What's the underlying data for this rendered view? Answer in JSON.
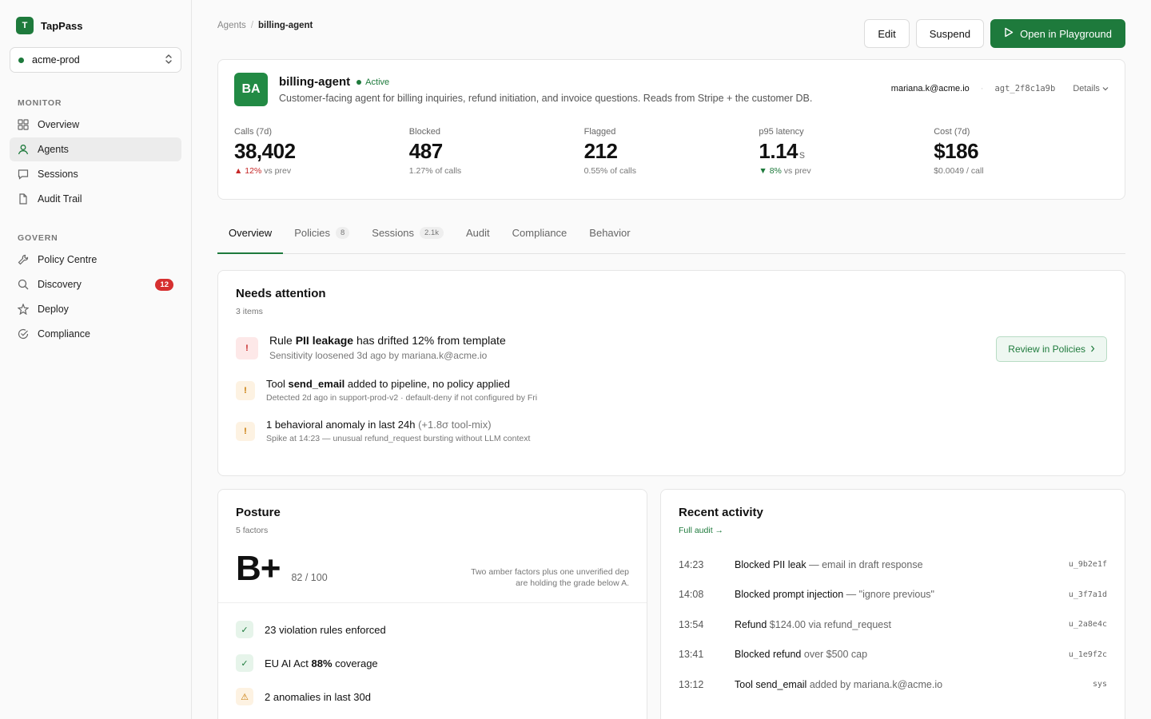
{
  "brand": {
    "logo_letter": "T",
    "name": "TapPass"
  },
  "environment": {
    "name": "acme-prod",
    "status_color": "#1e7a3c"
  },
  "sidebar": {
    "sections": [
      {
        "title": "MONITOR",
        "items": [
          {
            "label": "Overview",
            "icon": "grid-icon"
          },
          {
            "label": "Agents",
            "icon": "user-icon",
            "active": true
          },
          {
            "label": "Sessions",
            "icon": "chat-icon"
          },
          {
            "label": "Audit Trail",
            "icon": "document-icon"
          }
        ]
      },
      {
        "title": "GOVERN",
        "items": [
          {
            "label": "Policy Centre",
            "icon": "wrench-icon"
          },
          {
            "label": "Discovery",
            "icon": "search-icon",
            "badge": "12"
          },
          {
            "label": "Deploy",
            "icon": "sparkle-icon"
          },
          {
            "label": "Compliance",
            "icon": "check-circle-icon"
          }
        ]
      }
    ]
  },
  "breadcrumb": {
    "parent": "Agents",
    "current": "billing-agent"
  },
  "toolbar": {
    "edit_label": "Edit",
    "suspend_label": "Suspend",
    "playground_label": "Open in Playground"
  },
  "agent": {
    "initials": "BA",
    "name": "billing-agent",
    "status": "Active",
    "description": "Customer-facing agent for billing inquiries, refund initiation, and invoice questions. Reads from Stripe + the customer DB.",
    "owner": "mariana.k@acme.io",
    "id": "agt_2f8c1a9b",
    "details_label": "Details"
  },
  "stats": [
    {
      "label": "Calls (7d)",
      "value": "38,402",
      "unit": "",
      "sub_change": "▲ 12%",
      "sub_change_dir": "up",
      "sub_text": " vs prev"
    },
    {
      "label": "Blocked",
      "value": "487",
      "unit": "",
      "sub_change": "",
      "sub_change_dir": "",
      "sub_text": "1.27% of calls"
    },
    {
      "label": "Flagged",
      "value": "212",
      "unit": "",
      "sub_change": "",
      "sub_change_dir": "",
      "sub_text": "0.55% of calls"
    },
    {
      "label": "p95 latency",
      "value": "1.14",
      "unit": "s",
      "sub_change": "▼ 8%",
      "sub_change_dir": "down",
      "sub_text": " vs prev"
    },
    {
      "label": "Cost (7d)",
      "value": "$186",
      "unit": "",
      "sub_change": "",
      "sub_change_dir": "",
      "sub_text": "$0.0049 / call"
    }
  ],
  "tabs": [
    {
      "label": "Overview",
      "count": "",
      "active": true
    },
    {
      "label": "Policies",
      "count": "8"
    },
    {
      "label": "Sessions",
      "count": "2.1k"
    },
    {
      "label": "Audit",
      "count": ""
    },
    {
      "label": "Compliance",
      "count": ""
    },
    {
      "label": "Behavior",
      "count": ""
    }
  ],
  "attention": {
    "title": "Needs attention",
    "subtitle": "3 items",
    "items": [
      {
        "severity": "red",
        "icon": "!",
        "pre": "Rule ",
        "bold": "PII leakage",
        "post": " has drifted 12% from template",
        "muted": "",
        "desc": "Sensitivity loosened 3d ago by mariana.k@acme.io",
        "action": "Review in Policies"
      },
      {
        "severity": "amber",
        "icon": "!",
        "pre": "Tool ",
        "bold": "send_email",
        "post": " added to pipeline, no policy applied",
        "muted": "",
        "desc": "Detected 2d ago in support-prod-v2 · default-deny if not configured by Fri",
        "action": ""
      },
      {
        "severity": "amber",
        "icon": "!",
        "pre": "1 behavioral anomaly in last 24h ",
        "bold": "",
        "post": "",
        "muted": "(+1.8σ tool-mix)",
        "desc": "Spike at 14:23 — unusual refund_request bursting without LLM context",
        "action": ""
      }
    ]
  },
  "posture": {
    "title": "Posture",
    "subtitle": "5 factors",
    "grade": "B+",
    "score": "82 / 100",
    "note": "Two amber factors plus one unverified dep are holding the grade below A.",
    "factors": [
      {
        "status": "ok",
        "icon": "✓",
        "pre": "23 violation rules enforced",
        "bold": "",
        "post": ""
      },
      {
        "status": "ok",
        "icon": "✓",
        "pre": "EU AI Act ",
        "bold": "88%",
        "post": " coverage"
      },
      {
        "status": "warn",
        "icon": "⚠",
        "pre": "2 anomalies in last 30d",
        "bold": "",
        "post": ""
      }
    ]
  },
  "activity": {
    "title": "Recent activity",
    "link": "Full audit →",
    "rows": [
      {
        "time": "14:23",
        "main": "Blocked PII leak",
        "muted": " — email in draft response",
        "id": "u_9b2e1f"
      },
      {
        "time": "14:08",
        "main": "Blocked prompt injection",
        "muted": " — \"ignore previous\"",
        "id": "u_3f7a1d"
      },
      {
        "time": "13:54",
        "main": "Refund",
        "muted": " $124.00 via refund_request",
        "id": "u_2a8e4c"
      },
      {
        "time": "13:41",
        "main": "Blocked refund",
        "muted": " over $500 cap",
        "id": "u_1e9f2c"
      },
      {
        "time": "13:12",
        "main": "Tool send_email",
        "muted": " added by mariana.k@acme.io",
        "id": "sys"
      }
    ]
  },
  "colors": {
    "accent": "#1e7a3c",
    "danger": "#c62828",
    "warning": "#c77700"
  }
}
